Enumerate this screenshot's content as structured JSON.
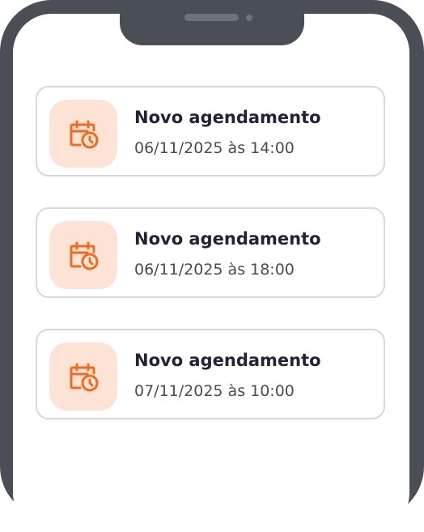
{
  "notifications": [
    {
      "icon": "calendar-clock-icon",
      "title": "Novo agendamento",
      "datetime": "06/11/2025 às 14:00"
    },
    {
      "icon": "calendar-clock-icon",
      "title": "Novo agendamento",
      "datetime": "06/11/2025 às 18:00"
    },
    {
      "icon": "calendar-clock-icon",
      "title": "Novo agendamento",
      "datetime": "07/11/2025 às 10:00"
    }
  ],
  "colors": {
    "accent": "#f26b1d",
    "icon_tile_bg": "#fde2d6",
    "frame": "#4a4e56",
    "title_text": "#252238",
    "time_text": "#4b4b55",
    "card_border": "#d8d8dc"
  }
}
